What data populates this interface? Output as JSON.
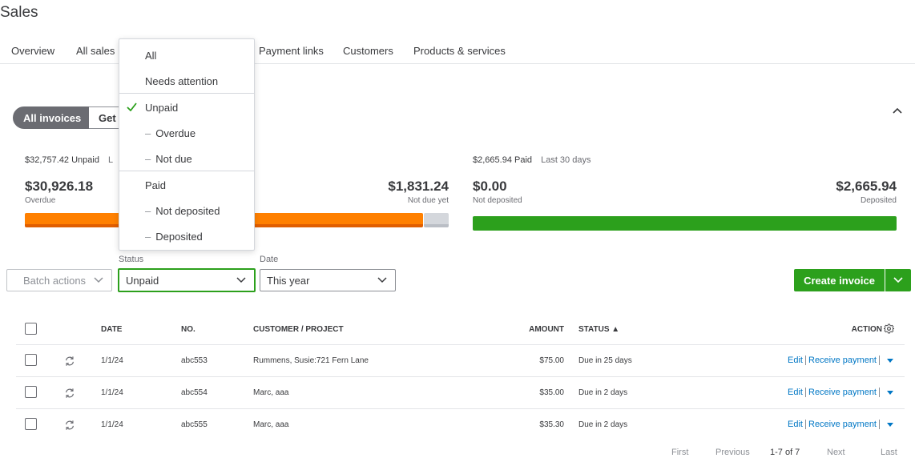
{
  "page": {
    "title": "Sales"
  },
  "tabs": [
    "Overview",
    "All sales",
    "Payment links",
    "Customers",
    "Products & services"
  ],
  "segment": {
    "active": "All invoices",
    "other": "Get"
  },
  "unpaid_summary": {
    "headline": "$32,757.42 Unpaid",
    "headline_suffix": "L",
    "overdue_amount": "$30,926.18",
    "overdue_label": "Overdue",
    "not_due_amount": "$1,831.24",
    "not_due_label": "Not due yet"
  },
  "paid_summary": {
    "headline": "$2,665.94 Paid",
    "period": "Last 30 days",
    "not_deposited_amount": "$0.00",
    "not_deposited_label": "Not deposited",
    "deposited_amount": "$2,665.94",
    "deposited_label": "Deposited"
  },
  "filters": {
    "batch_actions": "Batch actions",
    "status_label": "Status",
    "status_value": "Unpaid",
    "date_label": "Date",
    "date_value": "This year"
  },
  "create_invoice_label": "Create invoice",
  "status_dropdown": {
    "items": [
      {
        "label": "All",
        "indent": false,
        "checked": false
      },
      {
        "label": "Needs attention",
        "indent": false,
        "checked": false
      },
      {
        "label": "Unpaid",
        "indent": false,
        "checked": true
      },
      {
        "label": "Overdue",
        "indent": true,
        "checked": false
      },
      {
        "label": "Not due",
        "indent": true,
        "checked": false
      },
      {
        "label": "Paid",
        "indent": false,
        "checked": false
      },
      {
        "label": "Not deposited",
        "indent": true,
        "checked": false
      },
      {
        "label": "Deposited",
        "indent": true,
        "checked": false
      }
    ],
    "dash": "–"
  },
  "table": {
    "headers": {
      "date": "DATE",
      "no": "NO.",
      "customer": "CUSTOMER / PROJECT",
      "amount": "AMOUNT",
      "status": "STATUS ▲",
      "action": "ACTION"
    },
    "rows": [
      {
        "date": "1/1/24",
        "no": "abc553",
        "customer": "Rummens, Susie:721 Fern Lane",
        "amount": "$75.00",
        "status": "Due in 25 days"
      },
      {
        "date": "1/1/24",
        "no": "abc554",
        "customer": "Marc, aaa",
        "amount": "$35.00",
        "status": "Due in 2 days"
      },
      {
        "date": "1/1/24",
        "no": "abc555",
        "customer": "Marc, aaa",
        "amount": "$35.30",
        "status": "Due in 2 days"
      }
    ],
    "row_actions": {
      "edit": "Edit",
      "receive": "Receive payment"
    }
  },
  "pagination": {
    "first": "First",
    "previous": "Previous",
    "range": "1-7 of 7",
    "next": "Next",
    "last": "Last"
  },
  "colors": {
    "accent_green": "#2ca01c",
    "overdue_orange": "#ff8000",
    "link_blue": "#0077c5"
  }
}
